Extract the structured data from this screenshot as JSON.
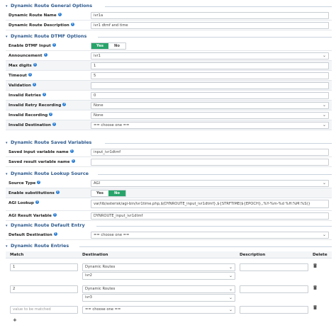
{
  "general": {
    "legend": "Dynamic Route General Options",
    "name_label": "Dynamic Route Name",
    "name_value": "ivr1a",
    "desc_label": "Dynamic Route Description",
    "desc_value": "ivr1 dtmf and time"
  },
  "dtmf": {
    "legend": "Dynamic Route DTMF Options",
    "enable_label": "Enable DTMF Input",
    "enable_yes": "Yes",
    "enable_no": "No",
    "enable_value": "Yes",
    "announcement_label": "Announcement",
    "announcement_value": "ivr1",
    "max_digits_label": "Max digits",
    "max_digits_value": "1",
    "timeout_label": "Timeout",
    "timeout_value": "5",
    "validation_label": "Validation",
    "validation_value": "",
    "invalid_retries_label": "Invalid Retries",
    "invalid_retries_value": "0",
    "invalid_retry_rec_label": "Invalid Retry Recording",
    "invalid_retry_rec_value": "None",
    "invalid_rec_label": "Invalid Recording",
    "invalid_rec_value": "None",
    "invalid_dest_label": "Invalid Destination",
    "invalid_dest_value": "== choose one =="
  },
  "saved": {
    "legend": "Dynamic Route Saved Variables",
    "input_label": "Saved input variable name",
    "input_value": "input_ivr1dtmf",
    "result_label": "Saved result variable name",
    "result_value": ""
  },
  "lookup": {
    "legend": "Dynamic Route Lookup Source",
    "source_type_label": "Source Type",
    "source_type_value": "AGI",
    "subst_label": "Enable substitutions",
    "subst_yes": "Yes",
    "subst_no": "No",
    "subst_value": "No",
    "agi_lookup_label": "AGI Lookup",
    "agi_lookup_value": "var/lib/asterisk/agi-bin/ivr1time.php,$(DYNROUTE_input_ivr1dtmf},${STRFTIME(${EPOCH},,%Y-%m-%d %H:%M:%S)}",
    "agi_result_label": "AGI Result Variable",
    "agi_result_value": "DYNROUTE_input_ivr1dtmf"
  },
  "default_entry": {
    "legend": "Dynamic Route Default Entry",
    "dest_label": "Default Destination",
    "dest_value": "== choose one =="
  },
  "entries": {
    "legend": "Dynamic Route Entries",
    "col_match": "Match",
    "col_destination": "Destination",
    "col_description": "Description",
    "col_delete": "Delete",
    "rows": [
      {
        "match": "1",
        "dest_type": "Dynamic Routes",
        "dest_value": "ivr2",
        "description": ""
      },
      {
        "match": "2",
        "dest_type": "Dynamic Routes",
        "dest_value": "ivr3",
        "description": ""
      }
    ],
    "new_row": {
      "match_placeholder": "value to be matched",
      "dest_type": "== choose one ==",
      "description": ""
    },
    "add_symbol": "+"
  },
  "colors": {
    "legend": "#2d5a8e",
    "toggle_on": "#28a46a",
    "help_icon": "#2d7fd3"
  }
}
